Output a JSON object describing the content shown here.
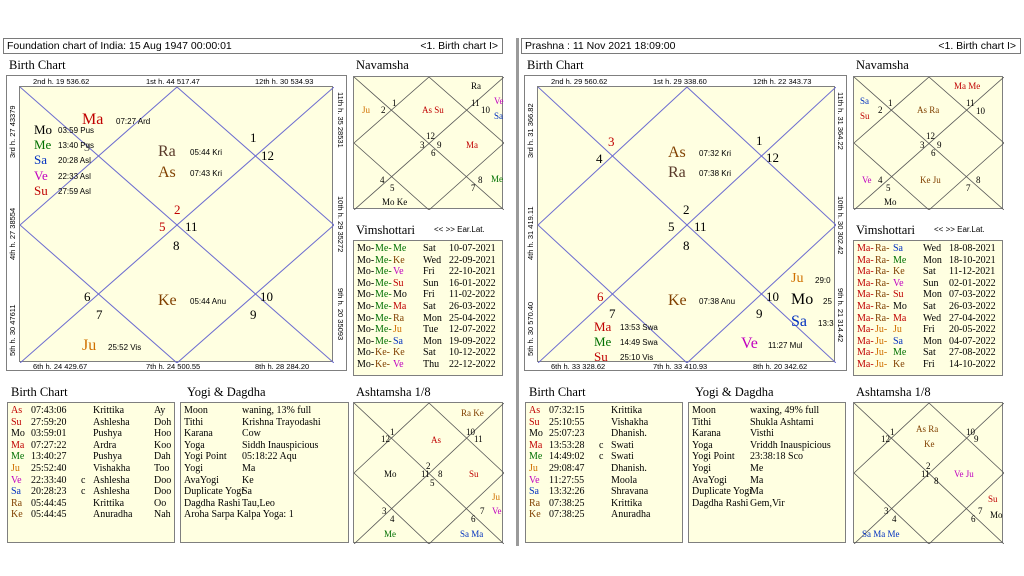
{
  "left": {
    "title": "Foundation chart of India:   15 Aug 1947  00:00:01",
    "nav": "<1. Birth chart I>",
    "birth_chart_title": "Birth Chart",
    "navamsha_title": "Navamsha",
    "vimshottari_title": "Vimshottari",
    "vim_nav": "<< >> Ear.Lat.",
    "birth_list_title": "Birth Chart",
    "yogi_title": "Yogi & Dagdha",
    "ashtamsha_title": "Ashtamsha 1/8",
    "house_labels": {
      "h2": "2nd h.  19  536.62",
      "h1": "1st h.  44  517.47",
      "h12": "12th h.  30  534.93",
      "h3": "3rd h.  27  43379",
      "h11": "11th h.  35  28531",
      "h4": "4th h.  27  38554",
      "h10": "10th h.  29  35272",
      "h5": "5th h.  30  47611",
      "h9": "9th h.  20  35093",
      "h6": "6th h.  24  429.67",
      "h7": "7th h.  24  500.55",
      "h8": "8th h.  28  284.20"
    },
    "chart": {
      "n1": "1",
      "n12": "12",
      "n2": "2",
      "n5": "5",
      "n11": "11",
      "n8": "8",
      "n6": "6",
      "n7": "7",
      "n10": "10",
      "n9": "9",
      "n3": "3",
      "n4": "4",
      "Ma": "Ma",
      "Ma_deg": "07:27  Ard",
      "Mo": "Mo",
      "Mo_deg": "03:59  Pus",
      "Me": "Me",
      "Me_deg": "13:40  Pus",
      "Sa": "Sa",
      "Sa_deg": "20:28  Asl",
      "Ve": "Ve",
      "Ve_deg": "22:33  Asl",
      "Su": "Su",
      "Su_deg": "27:59  Asl",
      "Ra": "Ra",
      "Ra_deg": "05:44  Kri",
      "As": "As",
      "As_deg": "07:43  Kri",
      "Ke": "Ke",
      "Ke_deg": "05:44  Anu",
      "Ju": "Ju",
      "Ju_deg": "25:52  Vis"
    },
    "navamsha": {
      "Ra": "Ra",
      "Ju": "Ju",
      "n2": "2",
      "n1": "1",
      "AsSu": "As Su",
      "n11": "11",
      "n10": "10",
      "Ve": "Ve",
      "Sa": "Sa",
      "n12": "12",
      "n3": "3",
      "n9": "9",
      "n6": "6",
      "Ma": "Ma",
      "n4": "4",
      "n5": "5",
      "n8": "8",
      "n7": "7",
      "Me": "Me",
      "MoKe": "Mo Ke"
    },
    "vimshottari": [
      [
        "Mo-",
        "Me-",
        "Me",
        "Sat",
        "10-07-2021"
      ],
      [
        "Mo-",
        "Me-",
        "Ke",
        "Wed",
        "22-09-2021"
      ],
      [
        "Mo-",
        "Me-",
        "Ve",
        "Fri",
        "22-10-2021"
      ],
      [
        "Mo-",
        "Me-",
        "Su",
        "Sun",
        "16-01-2022"
      ],
      [
        "Mo-",
        "Me-",
        "Mo",
        "Fri",
        "11-02-2022"
      ],
      [
        "Mo-",
        "Me-",
        "Ma",
        "Sat",
        "26-03-2022"
      ],
      [
        "Mo-",
        "Me-",
        "Ra",
        "Mon",
        "25-04-2022"
      ],
      [
        "Mo-",
        "Me-",
        "Ju",
        "Tue",
        "12-07-2022"
      ],
      [
        "Mo-",
        "Me-",
        "Sa",
        "Mon",
        "19-09-2022"
      ],
      [
        "Mo-",
        "Ke-",
        "Ke",
        "Sat",
        "10-12-2022"
      ],
      [
        "Mo-",
        "Ke-",
        "Ve",
        "Thu",
        "22-12-2022"
      ]
    ],
    "birth_list": [
      [
        "As",
        "07:43:06",
        "",
        "Krittika",
        "Ay"
      ],
      [
        "Su",
        "27:59:20",
        "",
        "Ashlesha",
        "Doh"
      ],
      [
        "Mo",
        "03:59:01",
        "",
        "Pushya",
        "Hoo"
      ],
      [
        "Ma",
        "07:27:22",
        "",
        "Ardra",
        "Koo"
      ],
      [
        "Me",
        "13:40:27",
        "",
        "Pushya",
        "Dah"
      ],
      [
        "Ju",
        "25:52:40",
        "",
        "Vishakha",
        "Too"
      ],
      [
        "Ve",
        "22:33:40",
        "c",
        "Ashlesha",
        "Doo"
      ],
      [
        "Sa",
        "20:28:23",
        "c",
        "Ashlesha",
        "Doo"
      ],
      [
        "Ra",
        "05:44:45",
        "",
        "Krittika",
        "Oo"
      ],
      [
        "Ke",
        "05:44:45",
        "",
        "Anuradha",
        "Nah"
      ]
    ],
    "yogi": [
      [
        "Moon",
        "waning, 13% full"
      ],
      [
        "Tithi",
        "Krishna  Trayodashi"
      ],
      [
        "Karana",
        "Cow"
      ],
      [
        "Yoga",
        "Siddh Inauspicious"
      ],
      [
        "Yogi Point",
        "05:18:22 Aqu"
      ],
      [
        "Yogi",
        "Ma"
      ],
      [
        "AvaYogi",
        "Ke"
      ],
      [
        "Duplicate Yogi",
        "Sa"
      ],
      [
        "Dagdha Rashi",
        "Tau,Leo"
      ],
      [
        "Aroha Sarpa Kalpa Yoga: 1",
        ""
      ]
    ],
    "ashtamsha": {
      "RaKe": "Ra Ke",
      "n1": "1",
      "n12": "12",
      "As": "As",
      "n10": "10",
      "n11": "11",
      "n2": "2",
      "n3": "3",
      "n8": "8",
      "Mo": "Mo",
      "Su": "Su",
      "n9": "9",
      "n5": "5",
      "n4": "4",
      "n6": "6",
      "n7": "7",
      "Ju": "Ju",
      "Ve": "Ve",
      "Me": "Me",
      "SaMa": "Sa Ma"
    }
  },
  "right": {
    "title": "Prashna :   11 Nov 2021  18:09:00",
    "nav": "<1. Birth chart I>",
    "birth_chart_title": "Birth Chart",
    "navamsha_title": "Navamsha",
    "vimshottari_title": "Vimshottari",
    "vim_nav": "<< >> Ear.Lat.",
    "birth_list_title": "Birth Chart",
    "yogi_title": "Yogi & Dagdha",
    "ashtamsha_title": "Ashtamsha 1/8",
    "house_labels": {
      "h2": "2nd h.  29  560.62",
      "h1": "1st h.  29  338.60",
      "h12": "12th h.  22  343.73",
      "h3": "3rd h.  31  366.82",
      "h11": "11th h.  31  364.22",
      "h4": "4th h.  31  419.11",
      "h10": "10th h.  30  302.42",
      "h5": "5th h.  30  570.40",
      "h9": "9th h.  21  314.42",
      "h6": "6th h.  33  328.62",
      "h7": "7th h.  33  410.93",
      "h8": "8th h.  20  342.62"
    },
    "chart": {
      "n3": "3",
      "n4": "4",
      "n1": "1",
      "n12": "12",
      "n2": "2",
      "n5": "5",
      "n11": "11",
      "n8": "8",
      "n6": "6",
      "n7": "7",
      "n10": "10",
      "n9": "9",
      "As": "As",
      "As_deg": "07:32  Kri",
      "Ra": "Ra",
      "Ra_deg": "07:38  Kri",
      "Ke": "Ke",
      "Ke_deg": "07:38  Anu",
      "Ju": "Ju",
      "Ju_deg": "29:0",
      "Mo": "Mo",
      "Mo_deg": "25",
      "Sa": "Sa",
      "Sa_deg": "13:3",
      "Ma": "Ma",
      "Ma_deg": "13:53  Swa",
      "Me": "Me",
      "Me_deg": "14:49  Swa",
      "Su": "Su",
      "Su_deg": "25:10  Vis",
      "Ve": "Ve",
      "Ve_deg": "11:27  Mul"
    },
    "navamsha": {
      "MaMe": "Ma Me",
      "Sa": "Sa",
      "Su": "Su",
      "n2": "2",
      "n1": "1",
      "AsRa": "As Ra",
      "n11": "11",
      "n10": "10",
      "n12": "12",
      "n3": "3",
      "n9": "9",
      "n6": "6",
      "Ve": "Ve",
      "n4": "4",
      "n5": "5",
      "KeJu": "Ke Ju",
      "n7": "7",
      "n8": "8",
      "Mo": "Mo"
    },
    "vimshottari": [
      [
        "Ma-",
        "Ra-",
        "Sa",
        "Wed",
        "18-08-2021"
      ],
      [
        "Ma-",
        "Ra-",
        "Me",
        "Mon",
        "18-10-2021"
      ],
      [
        "Ma-",
        "Ra-",
        "Ke",
        "Sat",
        "11-12-2021"
      ],
      [
        "Ma-",
        "Ra-",
        "Ve",
        "Sun",
        "02-01-2022"
      ],
      [
        "Ma-",
        "Ra-",
        "Su",
        "Mon",
        "07-03-2022"
      ],
      [
        "Ma-",
        "Ra-",
        "Mo",
        "Sat",
        "26-03-2022"
      ],
      [
        "Ma-",
        "Ra-",
        "Ma",
        "Wed",
        "27-04-2022"
      ],
      [
        "Ma-",
        "Ju-",
        "Ju",
        "Fri",
        "20-05-2022"
      ],
      [
        "Ma-",
        "Ju-",
        "Sa",
        "Mon",
        "04-07-2022"
      ],
      [
        "Ma-",
        "Ju-",
        "Me",
        "Sat",
        "27-08-2022"
      ],
      [
        "Ma-",
        "Ju-",
        "Ke",
        "Fri",
        "14-10-2022"
      ]
    ],
    "birth_list": [
      [
        "As",
        "07:32:15",
        "",
        "Krittika",
        ""
      ],
      [
        "Su",
        "25:10:55",
        "",
        "Vishakha",
        ""
      ],
      [
        "Mo",
        "25:07:23",
        "",
        "Dhanish.",
        ""
      ],
      [
        "Ma",
        "13:53:28",
        "c",
        "Swati",
        ""
      ],
      [
        "Me",
        "14:49:02",
        "c",
        "Swati",
        ""
      ],
      [
        "Ju",
        "29:08:47",
        "",
        "Dhanish.",
        ""
      ],
      [
        "Ve",
        "11:27:55",
        "",
        "Moola",
        ""
      ],
      [
        "Sa",
        "13:32:26",
        "",
        "Shravana",
        ""
      ],
      [
        "Ra",
        "07:38:25",
        "",
        "Krittika",
        ""
      ],
      [
        "Ke",
        "07:38:25",
        "",
        "Anuradha",
        ""
      ]
    ],
    "yogi": [
      [
        "Moon",
        "waxing, 49% full"
      ],
      [
        "Tithi",
        "Shukla  Ashtami"
      ],
      [
        "Karana",
        "Visthi"
      ],
      [
        "Yoga",
        "Vriddh Inauspicious"
      ],
      [
        "Yogi Point",
        "23:38:18 Sco"
      ],
      [
        "Yogi",
        "Me"
      ],
      [
        "AvaYogi",
        "Ma"
      ],
      [
        "Duplicate Yogi",
        "Ma"
      ],
      [
        "Dagdha Rashi",
        "Gem,Vir"
      ]
    ],
    "ashtamsha": {
      "AsRa": "As Ra",
      "Ke": "Ke",
      "n1": "1",
      "n12": "12",
      "n10": "10",
      "n9": "9",
      "n2": "2",
      "n11": "11",
      "n8": "8",
      "VeJu": "Ve Ju",
      "Su": "Su",
      "n3": "3",
      "n4": "4",
      "n6": "6",
      "n5": "5",
      "n7": "7",
      "Mo": "Mo",
      "SaMaMe": "Sa Ma Me"
    }
  },
  "colors": {
    "panel": "#ffffe1",
    "red": "#c00000",
    "green": "#007000",
    "blue": "#0030c0",
    "magenta": "#c000c0",
    "orange": "#d07000",
    "brown": "#804000"
  }
}
